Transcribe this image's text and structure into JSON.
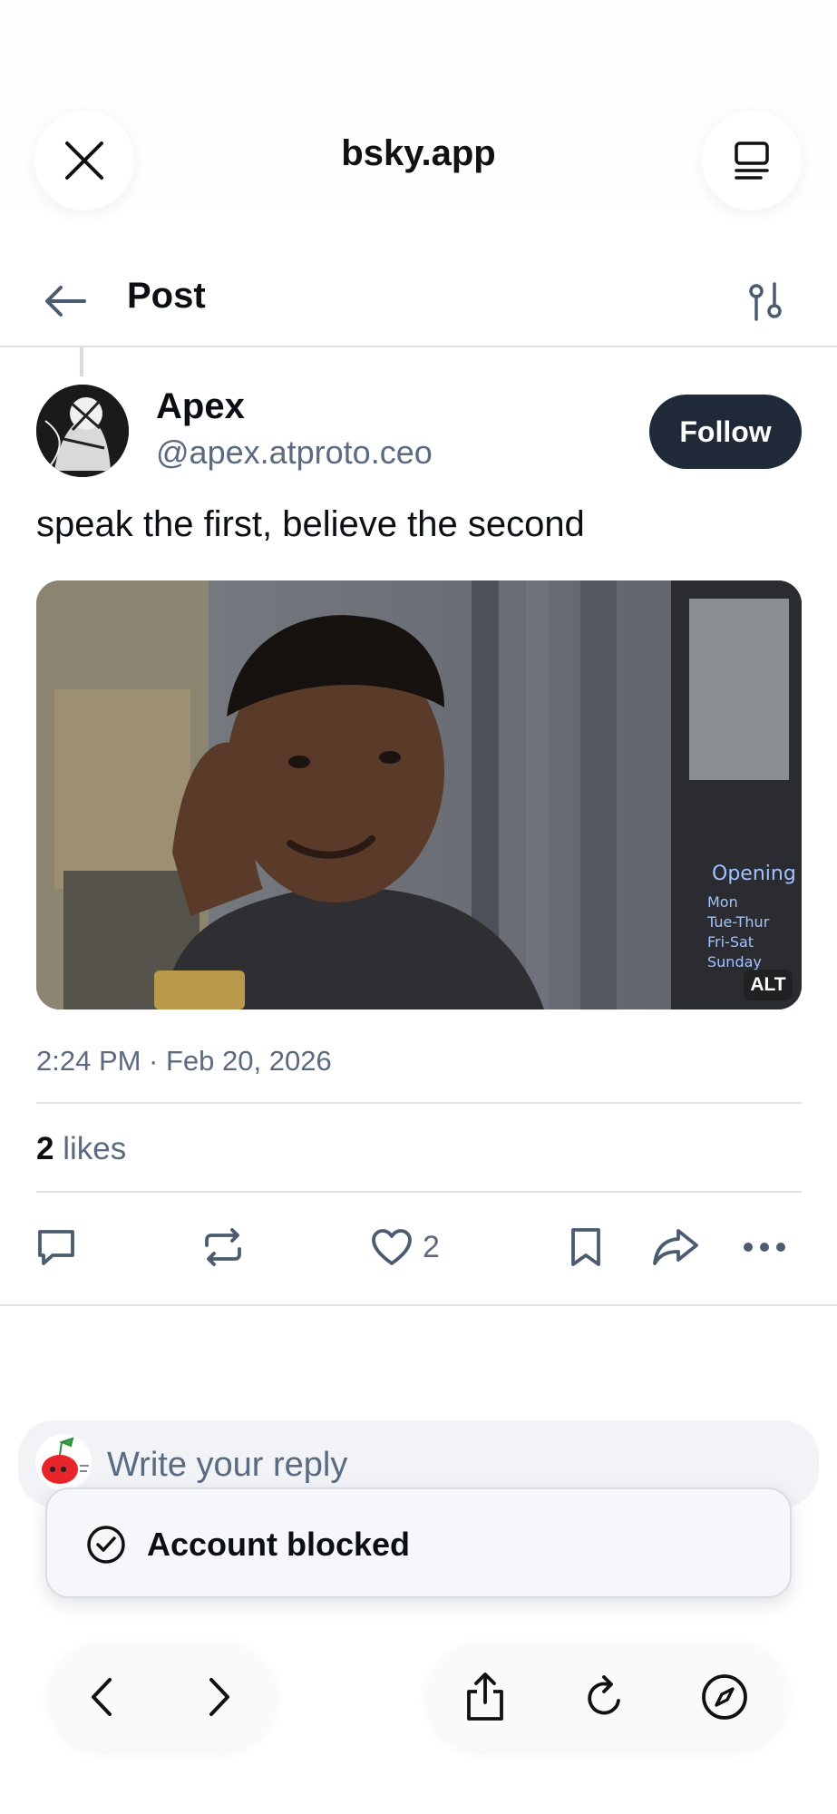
{
  "browser": {
    "url_title": "bsky.app",
    "icons": {
      "close": "close-icon",
      "reader": "reader-mode-icon",
      "back": "chevron-left-icon",
      "forward": "chevron-right-icon",
      "share": "share-icon",
      "reload": "reload-icon",
      "compass": "compass-icon"
    }
  },
  "header": {
    "title": "Post",
    "icons": {
      "back": "arrow-left-icon",
      "settings": "sliders-icon"
    }
  },
  "post": {
    "author_name": "Apex",
    "author_handle": "@apex.atproto.ceo",
    "follow_label": "Follow",
    "text": "speak the first, believe the second",
    "image_alt_badge": "ALT",
    "timestamp": "2:24 PM · Feb 20, 2026",
    "likes_count": "2",
    "likes_label": "likes",
    "actions": {
      "reply_icon": "reply-icon",
      "repost_icon": "repost-icon",
      "like_icon": "heart-icon",
      "like_count": "2",
      "bookmark_icon": "bookmark-icon",
      "share_icon": "share-arrow-icon",
      "more_icon": "more-icon"
    }
  },
  "reply": {
    "placeholder": "Write your reply"
  },
  "toast": {
    "text": "Account blocked",
    "icon": "check-circle-icon"
  },
  "colors": {
    "accent_dark": "#1f2937",
    "muted_text": "#5a6a80",
    "divider": "#dfe3e8"
  }
}
